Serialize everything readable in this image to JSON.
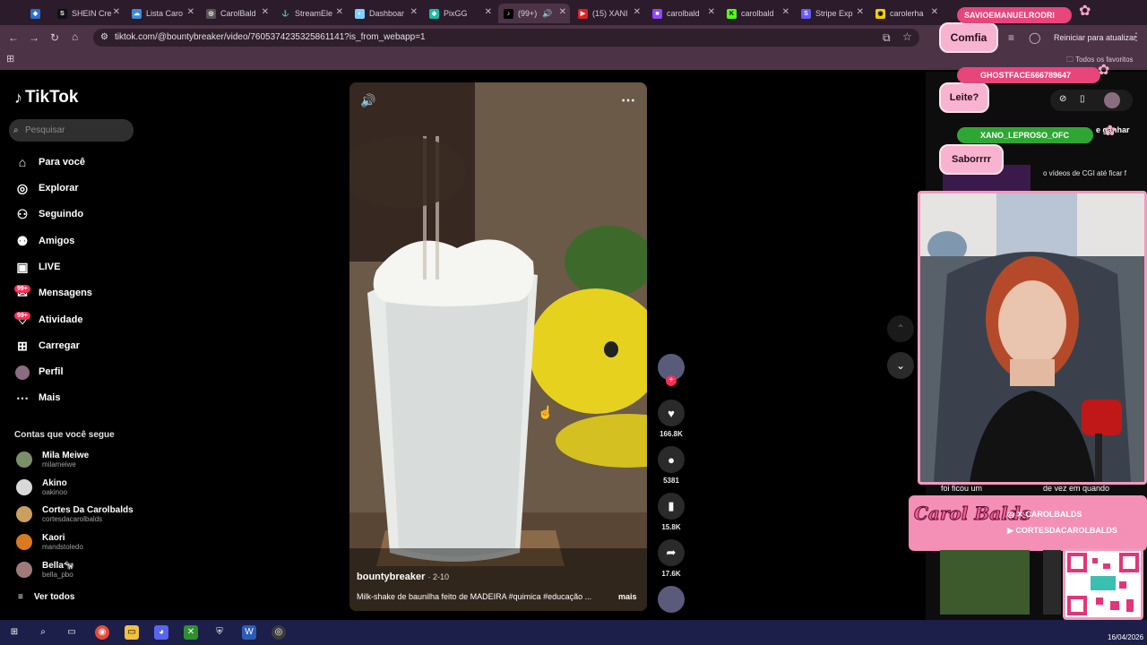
{
  "browser": {
    "tabs": [
      {
        "title": ""
      },
      {
        "title": "SHEIN Cre"
      },
      {
        "title": "Lista Caro"
      },
      {
        "title": "CarolBald"
      },
      {
        "title": "StreamEle"
      },
      {
        "title": "Dashboar"
      },
      {
        "title": "PixGG"
      },
      {
        "title": "(99+)"
      },
      {
        "title": "(15) XANI"
      },
      {
        "title": "carolbald"
      },
      {
        "title": "carolbald"
      },
      {
        "title": "Stripe Exp"
      },
      {
        "title": "carolerha"
      }
    ],
    "url": "tiktok.com/@bountybreaker/video/7605374235325861141?is_from_webapp=1",
    "restart_label": "Reiniciar para atualizar",
    "bookmarks_all": "Todos os favoritos"
  },
  "tiktok": {
    "brand": "TikTok",
    "search_placeholder": "Pesquisar",
    "nav": [
      {
        "label": "Para você",
        "icon": "home-icon"
      },
      {
        "label": "Explorar",
        "icon": "compass-icon"
      },
      {
        "label": "Seguindo",
        "icon": "following-icon"
      },
      {
        "label": "Amigos",
        "icon": "friends-icon"
      },
      {
        "label": "LIVE",
        "icon": "live-icon"
      },
      {
        "label": "Mensagens",
        "icon": "messages-icon",
        "badge": "99+"
      },
      {
        "label": "Atividade",
        "icon": "activity-icon",
        "badge": "99+"
      },
      {
        "label": "Carregar",
        "icon": "upload-icon"
      },
      {
        "label": "Perfil",
        "icon": "profile-icon"
      },
      {
        "label": "Mais",
        "icon": "more-icon"
      }
    ],
    "following_title": "Contas que você segue",
    "accounts": [
      {
        "name": "Mila Meiwe",
        "handle": "milameiwe"
      },
      {
        "name": "Akino",
        "handle": "oakinoo"
      },
      {
        "name": "Cortes Da Carolbalds",
        "handle": "cortesdacarolbalds"
      },
      {
        "name": "Kaori",
        "handle": "mandstoledo"
      },
      {
        "name": "Bella🐄",
        "handle": "bella_pbo"
      }
    ],
    "see_all": "Ver todos",
    "video": {
      "author": "bountybreaker",
      "date": "· 2-10",
      "caption": "Milk-shake de baunilha feito de MADEIRA #quimica #educação ...",
      "more": "mais"
    },
    "actions": {
      "likes": "166.8K",
      "comments": "5381",
      "saves": "15.8K",
      "shares": "17.6K"
    }
  },
  "stream_overlay": {
    "chat": [
      {
        "text": "Comfia"
      },
      {
        "text": "Leite?"
      },
      {
        "text": "Saborrrr"
      }
    ],
    "names": [
      {
        "text": "SAVIOEMANUELRODRI"
      },
      {
        "text": "GHOSTFACE666789647"
      },
      {
        "text": "XANO_LEPROSO_OFC"
      }
    ],
    "snippets": [
      {
        "text": "o vídeos de CGI até ficar f"
      },
      {
        "text": "e ganhar"
      },
      {
        "text": "foi ficou um"
      },
      {
        "text": "de vez em quando"
      }
    ],
    "brand_script": "Carol Balds",
    "socials": [
      {
        "text": "CAROLBALDS"
      },
      {
        "text": "CORTESDACAROLBALDS"
      }
    ]
  },
  "taskbar": {
    "date": "16/04/2026"
  }
}
